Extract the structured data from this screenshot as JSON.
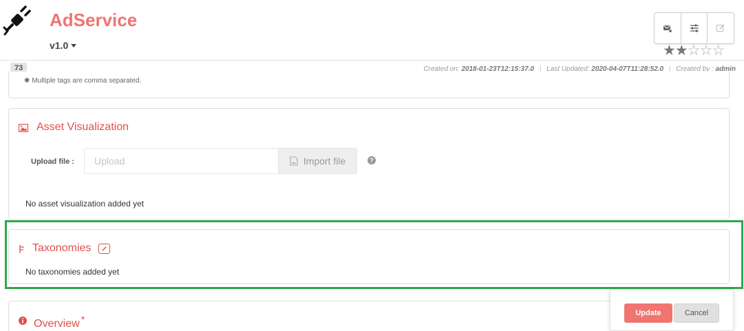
{
  "header": {
    "title": "AdService",
    "version": "v1.0",
    "actions": [
      {
        "icon": "message-icon"
      },
      {
        "icon": "sliders-icon"
      },
      {
        "icon": "edit-icon"
      }
    ],
    "rating": {
      "value": 2,
      "max": 5
    }
  },
  "meta": {
    "asset_id": "73",
    "created_label": "Created on:",
    "created_value": "2018-01-23T12:15:37.0",
    "updated_label": "Last Updated:",
    "updated_value": "2020-04-07T11:28:52.0",
    "by_label": "Created by :",
    "by_value": "admin"
  },
  "tags": {
    "help": "Multiple tags are comma separated."
  },
  "asset_visualization": {
    "title": "Asset Visualization",
    "upload_label": "Upload file :",
    "upload_placeholder": "Upload",
    "import_label": "Import file",
    "help_glyph": "?",
    "empty_text": "No asset visualization added yet"
  },
  "taxonomies": {
    "title": "Taxonomies",
    "empty_text": "No taxonomies added yet"
  },
  "overview": {
    "title": "Overview",
    "required": "*"
  },
  "footer": {
    "update_label": "Update",
    "cancel_label": "Cancel"
  },
  "colors": {
    "brand": "#f07470",
    "accent_red": "#e0504c",
    "highlight_green": "#2ea84a"
  }
}
